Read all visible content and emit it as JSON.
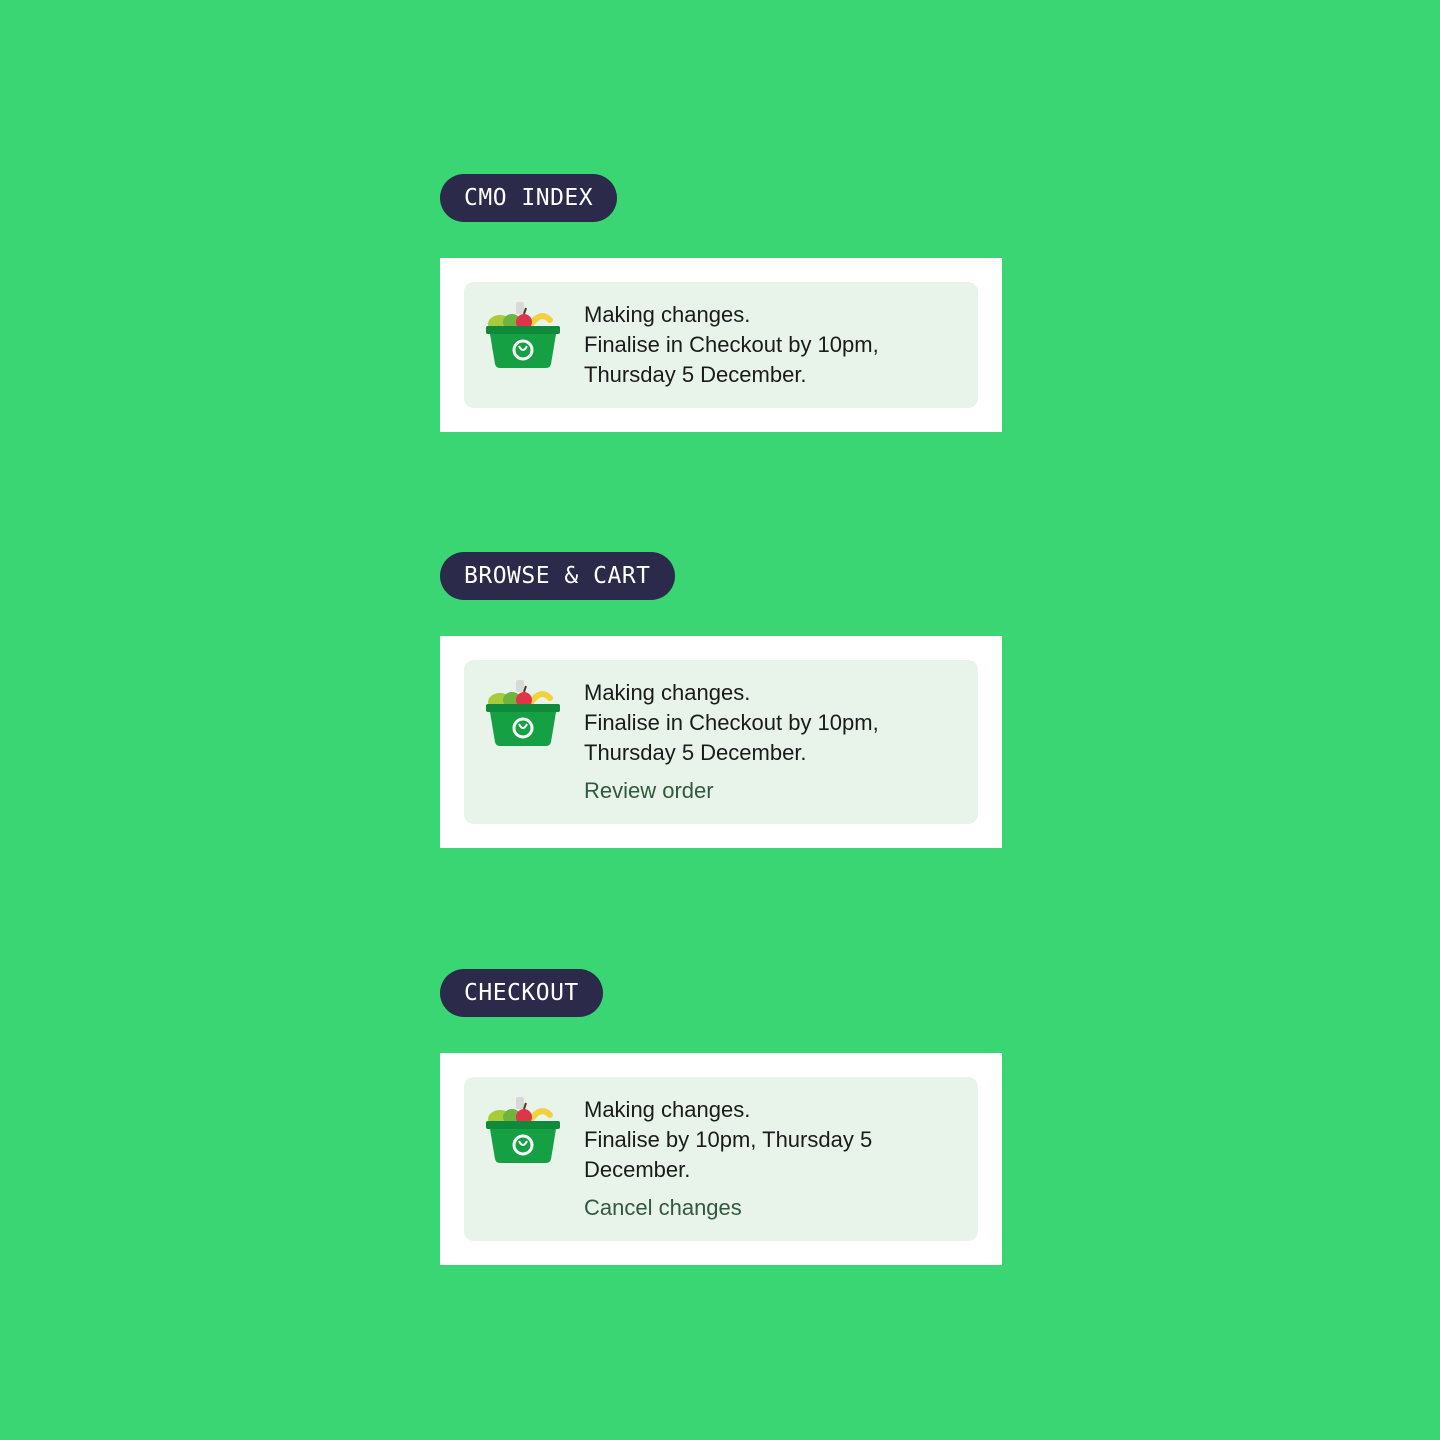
{
  "colors": {
    "background": "#3ad673",
    "tag_bg": "#2b2a4a",
    "banner_bg": "#e8f3ea",
    "action": "#2f5a3e"
  },
  "sections": [
    {
      "tag": "CMO INDEX",
      "lines": [
        "Making changes.",
        "Finalise in Checkout by 10pm,",
        "Thursday 5 December."
      ],
      "action": ""
    },
    {
      "tag": "BROWSE & CART",
      "lines": [
        "Making changes.",
        "Finalise in Checkout by 10pm,",
        "Thursday 5 December."
      ],
      "action": "Review order"
    },
    {
      "tag": "CHECKOUT",
      "lines": [
        "Making changes.",
        "Finalise by 10pm, Thursday 5",
        "December."
      ],
      "action": "Cancel changes"
    }
  ],
  "icon": "grocery-basket-icon"
}
